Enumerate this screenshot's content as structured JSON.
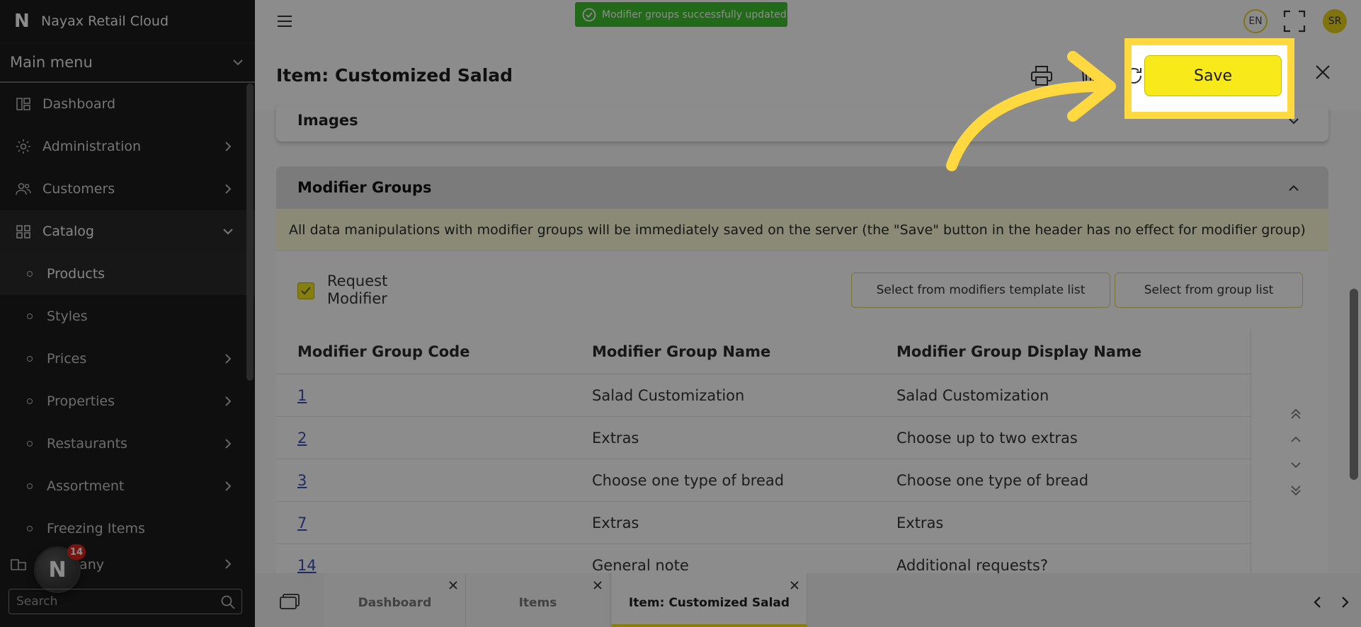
{
  "app": {
    "title": "Nayax Retail Cloud"
  },
  "sidebar": {
    "main_menu_label": "Main menu",
    "items": [
      {
        "label": "Dashboard",
        "icon": "dashboard-icon",
        "has_children": false
      },
      {
        "label": "Administration",
        "icon": "gear-icon",
        "has_children": true
      },
      {
        "label": "Customers",
        "icon": "users-icon",
        "has_children": true
      },
      {
        "label": "Catalog",
        "icon": "catalog-icon",
        "expanded": true
      }
    ],
    "catalog_children": [
      {
        "label": "Products",
        "selected": true
      },
      {
        "label": "Styles"
      },
      {
        "label": "Prices",
        "has_children": true
      },
      {
        "label": "Properties",
        "has_children": true
      },
      {
        "label": "Restaurants",
        "has_children": true
      },
      {
        "label": "Assortment",
        "has_children": true
      },
      {
        "label": "Freezing Items"
      },
      {
        "label": "pany",
        "has_children": true
      }
    ],
    "search_placeholder": "Search",
    "fab_badge": "14"
  },
  "topbar": {
    "toast": "Modifier groups successfully updated",
    "language": "EN",
    "avatar_initials": "SR"
  },
  "page": {
    "title": "Item: Customized Salad",
    "save_label": "Save"
  },
  "images_panel": {
    "title": "Images"
  },
  "modifier_groups": {
    "title": "Modifier Groups",
    "notice": "All data manipulations with modifier groups will be immediately saved on the server (the \"Save\" button in the header has no effect for modifier group)",
    "request_modifier_label": "Request Modifier",
    "request_modifier_checked": true,
    "btn_template_list": "Select from modifiers template list",
    "btn_group_list": "Select from group list",
    "columns": [
      "Modifier Group Code",
      "Modifier Group Name",
      "Modifier Group Display Name"
    ],
    "rows": [
      {
        "code": "1",
        "name": "Salad Customization",
        "display_name": "Salad Customization"
      },
      {
        "code": "2",
        "name": "Extras",
        "display_name": "Choose up to two extras"
      },
      {
        "code": "3",
        "name": "Choose one type of bread",
        "display_name": "Choose one type of bread"
      },
      {
        "code": "7",
        "name": "Extras",
        "display_name": "Extras"
      },
      {
        "code": "14",
        "name": "General note",
        "display_name": "Additional requests?"
      }
    ]
  },
  "tabs": [
    {
      "label": "Dashboard",
      "active": false
    },
    {
      "label": "Items",
      "active": false
    },
    {
      "label": "Item: Customized Salad",
      "active": true
    }
  ],
  "colors": {
    "accent_yellow": "#f8e91a",
    "highlight_frame": "#ffd93f",
    "toast_green": "#3fbf2e",
    "sidebar_bg": "#1c1c1c",
    "link_blue": "#3a4fb8"
  }
}
